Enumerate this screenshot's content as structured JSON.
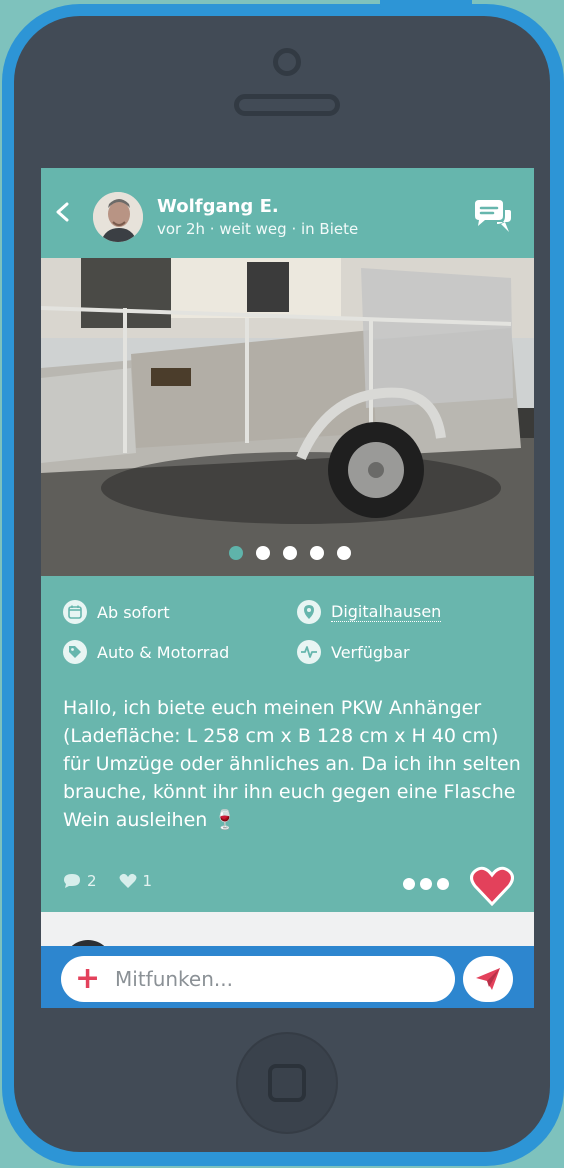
{
  "post": {
    "author_name": "Wolfgang E.",
    "meta": "vor 2h · weit weg · in Biete",
    "photo_dot_count": 5,
    "photo_active_dot": 1,
    "availability": "Ab sofort",
    "location": "Digitalhausen",
    "category": "Auto & Motorrad",
    "status": "Verfügbar",
    "description": "Hallo, ich biete euch meinen PKW Anhänger (Ladefläche: L 258 cm x B 128 cm x H 40 cm) für Umzüge oder ähnliches an. Da ich ihn selten brauche, könnt ihr ihn euch gegen eine Flasche Wein ausleihen 🍷",
    "comment_count": "2",
    "like_count": "1",
    "liked": true
  },
  "compose": {
    "placeholder": "Mitfunken..."
  },
  "colors": {
    "teal": "#66b6ad",
    "blue": "#2d86cf",
    "heart": "#e3415b",
    "phone_body": "#424b56"
  },
  "icons": {
    "back": "chevron-left-icon",
    "chat": "chat-bubbles-icon",
    "calendar": "calendar-icon",
    "location": "location-pin-icon",
    "tag": "tag-icon",
    "status": "activity-pulse-icon",
    "comment": "comment-icon",
    "like": "heart-icon",
    "more": "more-dots-icon",
    "add": "plus-icon",
    "send": "paper-plane-icon"
  }
}
